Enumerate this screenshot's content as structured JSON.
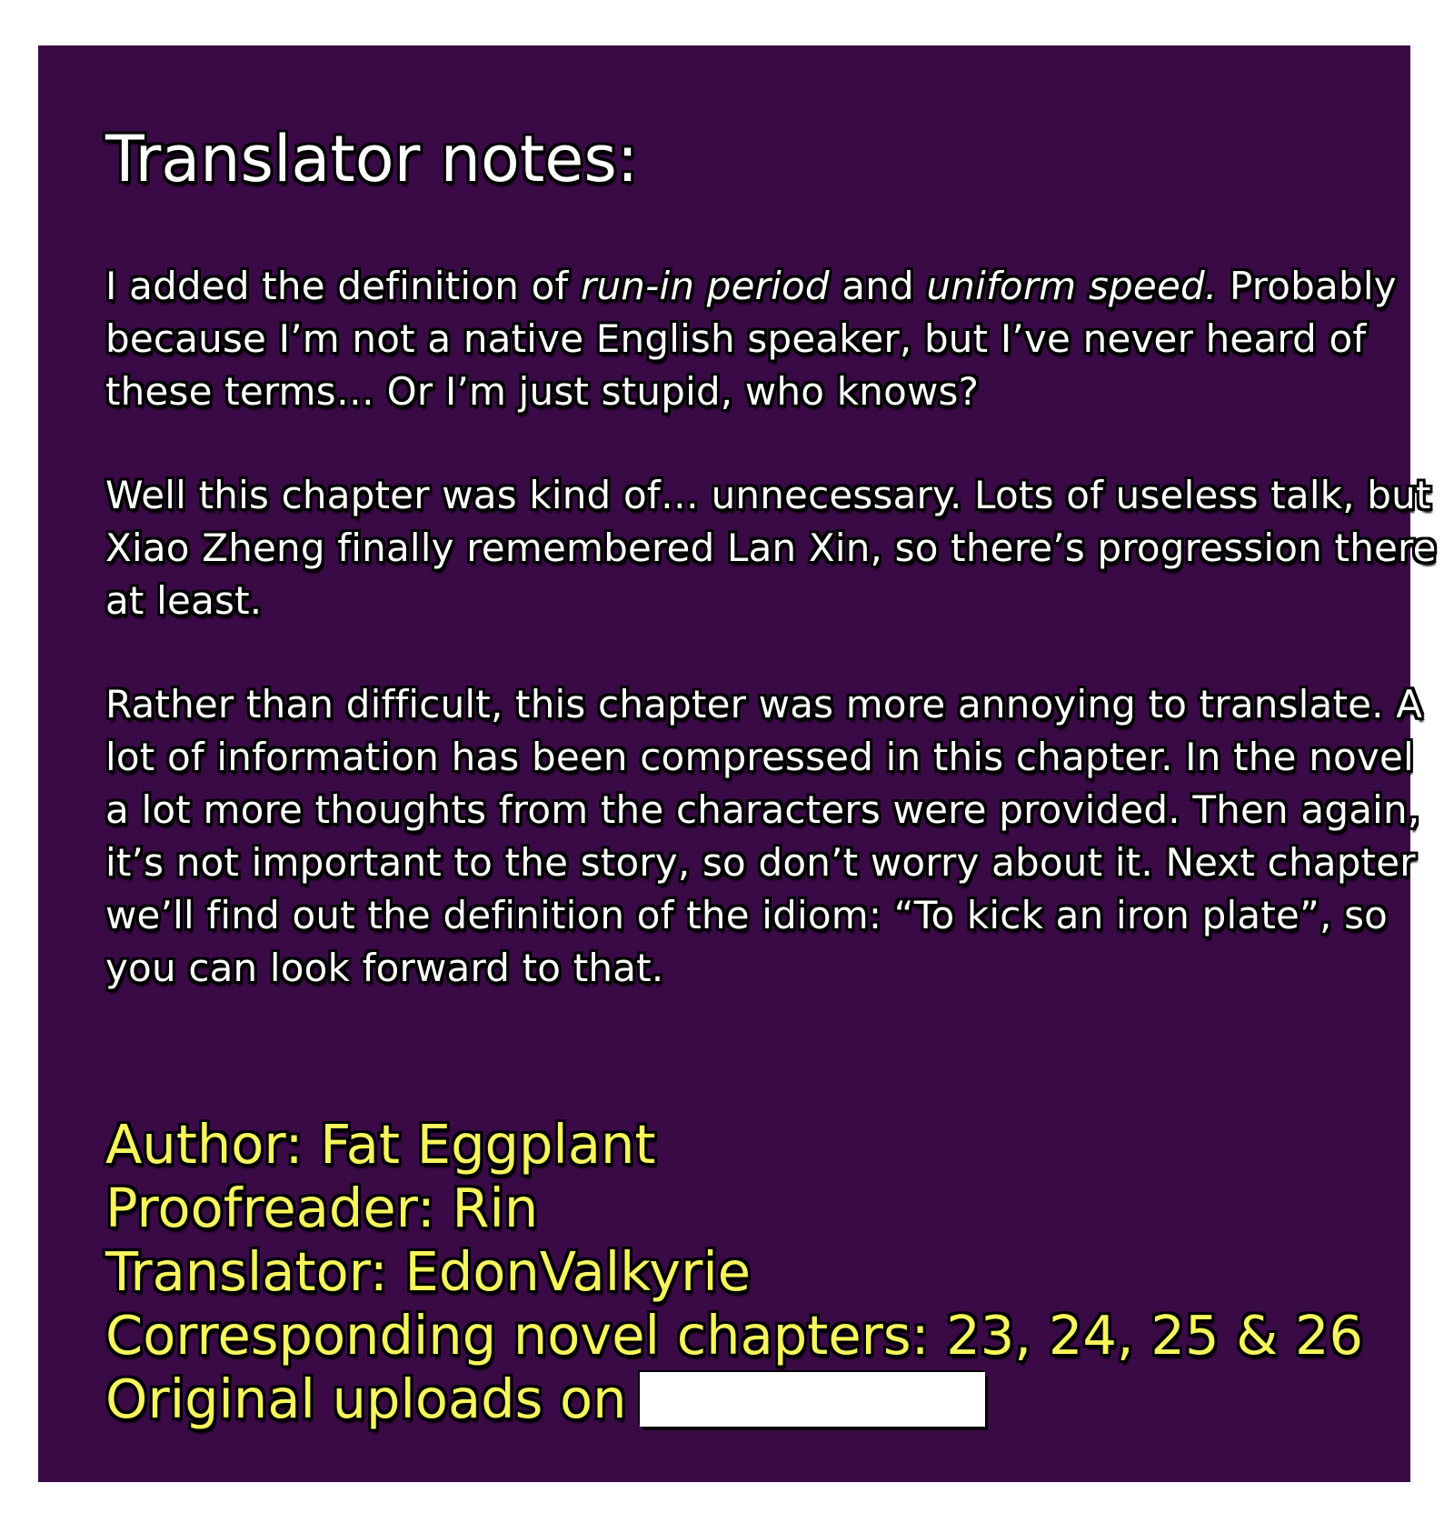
{
  "title": "Translator notes:",
  "para1": {
    "part1": "I added the definition of ",
    "term1": "run-in period",
    "part2": " and ",
    "term2": "uniform speed.",
    "part3": " Probably because I’m not a native English speaker, but I’ve never heard of these terms… Or I’m just stupid, who knows?"
  },
  "para2": "Well this chapter was kind of… unnecessary. Lots of useless talk, but Xiao Zheng finally remembered Lan Xin, so there’s progression there at least.",
  "para3": "Rather than difficult, this chapter was more annoying to translate. A lot of information has been compressed in this chapter. In the novel a lot more thoughts from the characters were provided. Then again, it’s not important to the story, so don’t worry about it. Next chapter we’ll find out the definition of the idiom: “To kick an iron plate”, so you can look forward to that.",
  "credits": {
    "author": "Author: Fat Eggplant",
    "proofreader": "Proofreader: Rin",
    "translator": "Translator: EdonValkyrie",
    "chapters": "Corresponding novel chapters: 23, 24, 25 & 26",
    "uploads": "Original uploads on"
  }
}
